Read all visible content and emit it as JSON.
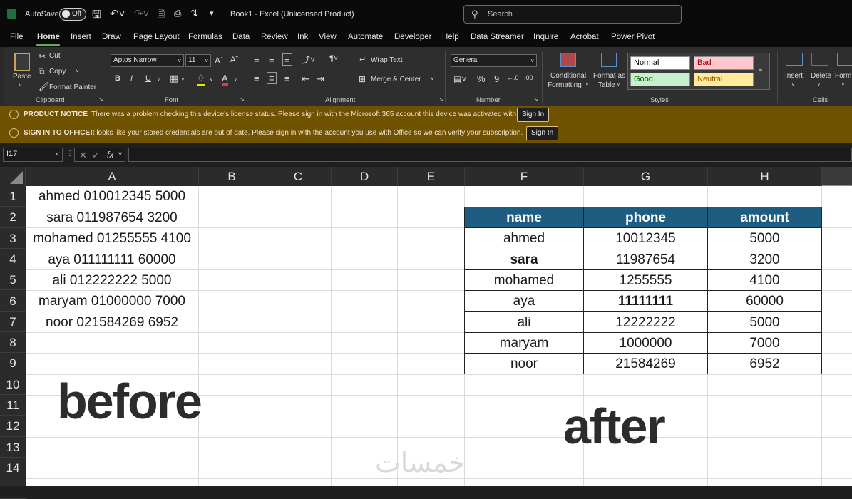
{
  "titlebar": {
    "autosave_label": "AutoSave",
    "autosave_state": "Off",
    "doc_name": "Book1",
    "separator": " - ",
    "app_name": "Excel (Unlicensed Product)",
    "search_placeholder": "Search"
  },
  "menu": [
    "File",
    "Home",
    "Insert",
    "Draw",
    "Page Layout",
    "Formulas",
    "Data",
    "Review",
    "Ink",
    "View",
    "Automate",
    "Developer",
    "Help",
    "Data Streamer",
    "Inquire",
    "Acrobat",
    "Power Pivot"
  ],
  "ribbon": {
    "clipboard": {
      "paste": "Paste",
      "cut": "Cut",
      "copy": "Copy",
      "format_painter": "Format Painter",
      "label": "Clipboard"
    },
    "font": {
      "name": "Aptos Narrow",
      "size": "11",
      "bold": "B",
      "italic": "I",
      "underline": "U",
      "label": "Font"
    },
    "alignment": {
      "wrap": "Wrap Text",
      "merge": "Merge & Center",
      "label": "Alignment"
    },
    "number": {
      "format": "General",
      "percent": "%",
      "comma": "9",
      "label": "Number"
    },
    "styles": {
      "conditional_1": "Conditional",
      "conditional_2": "Formatting",
      "table_1": "Format as",
      "table_2": "Table",
      "normal": "Normal",
      "bad": "Bad",
      "good": "Good",
      "neutral": "Neutral",
      "label": "Styles"
    },
    "cells": {
      "insert": "Insert",
      "delete": "Delete",
      "format": "Form",
      "label": "Cells"
    }
  },
  "notices": [
    {
      "title": "PRODUCT NOTICE",
      "message": "There was a problem checking this device's license status. Please sign in with the Microsoft 365 account this device was activated with.",
      "button": "Sign In"
    },
    {
      "title": "SIGN IN TO OFFICE",
      "message": "It looks like your stored credentials are out of date. Please sign in with the account you use with Office so we can verify your subscription.",
      "button": "Sign In"
    }
  ],
  "formula_bar": {
    "name_box": "I17",
    "fx": "fx",
    "formula": ""
  },
  "columns": [
    "A",
    "B",
    "C",
    "D",
    "E",
    "F",
    "G",
    "H"
  ],
  "rows": [
    "1",
    "2",
    "3",
    "4",
    "5",
    "6",
    "7",
    "8",
    "9",
    "10",
    "11",
    "12",
    "13",
    "14"
  ],
  "column_a": [
    "ahmed  010012345  5000",
    "sara 011987654  3200",
    "mohamed 01255555  4100",
    "aya 011111111  60000",
    "ali 012222222  5000",
    "maryam 01000000  7000",
    "noor 021584269  6952"
  ],
  "table": {
    "headers": [
      "name",
      "phone",
      "amount"
    ],
    "rows": [
      [
        "ahmed",
        "10012345",
        "5000"
      ],
      [
        "sara",
        "11987654",
        "3200"
      ],
      [
        "mohamed",
        "1255555",
        "4100"
      ],
      [
        "aya",
        "11111111",
        "60000"
      ],
      [
        "ali",
        "12222222",
        "5000"
      ],
      [
        "maryam",
        "1000000",
        "7000"
      ],
      [
        "noor",
        "21584269",
        "6952"
      ]
    ]
  },
  "overlay": {
    "before": "before",
    "after": "after",
    "watermark": "خمسات"
  },
  "colors": {
    "table_header": "#1f5c82",
    "notice_bg": "#6f5200",
    "accent": "#5fb14d"
  }
}
